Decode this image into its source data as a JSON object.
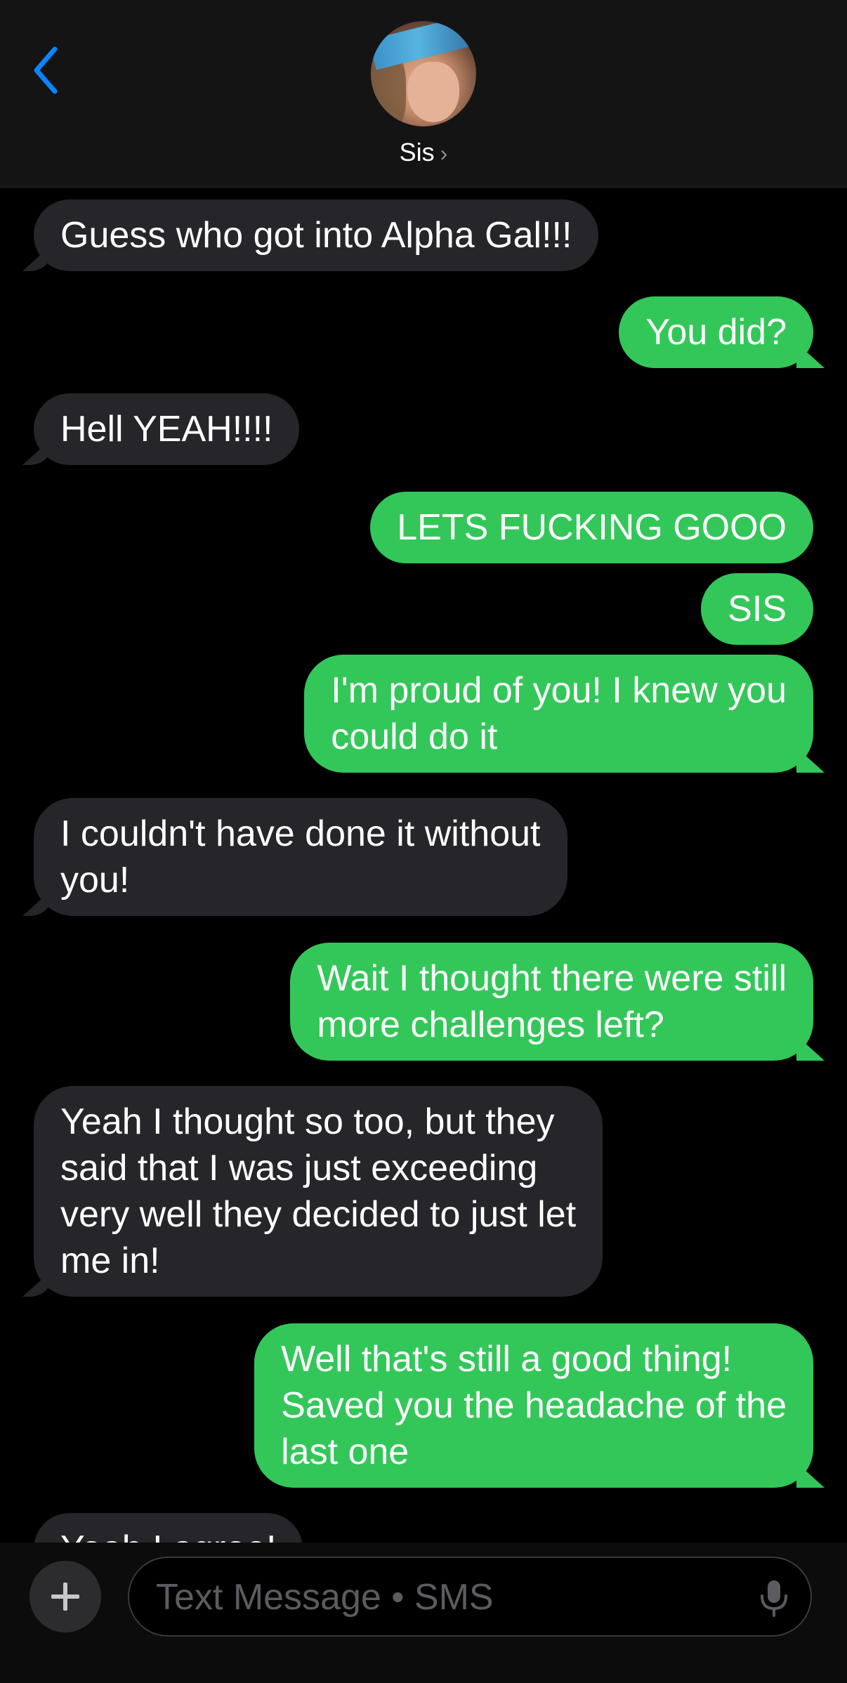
{
  "header": {
    "contact_name": "Sis",
    "chevron": "›"
  },
  "messages": [
    {
      "dir": "in",
      "text": "Guess who got into Alpha Gal!!!"
    },
    {
      "dir": "out",
      "text": "You did?"
    },
    {
      "dir": "in",
      "text": "Hell YEAH!!!!"
    },
    {
      "dir": "out",
      "text": "LETS FUCKING GOOO"
    },
    {
      "dir": "out",
      "text": "SIS"
    },
    {
      "dir": "out",
      "text": "I'm proud of you! I knew you\ncould do it"
    },
    {
      "dir": "in",
      "text": "I couldn't have done it without\nyou!"
    },
    {
      "dir": "out",
      "text": "Wait I thought there were still\nmore challenges left?"
    },
    {
      "dir": "in",
      "text": "Yeah I thought so too, but they\nsaid that I was just exceeding\nvery well they decided to just let\nme in!"
    },
    {
      "dir": "out",
      "text": "Well that's still a good thing!\nSaved you the headache of the\nlast one"
    },
    {
      "dir": "in",
      "text": "Yeah I agree!"
    }
  ],
  "composer": {
    "placeholder": "Text Message • SMS"
  },
  "colors": {
    "incoming_bubble": "#26252a",
    "outgoing_bubble": "#33c759",
    "accent": "#0a84ff",
    "background": "#000000"
  },
  "icons": {
    "back": "back-chevron-icon",
    "add": "plus-icon",
    "mic": "microphone-icon"
  }
}
